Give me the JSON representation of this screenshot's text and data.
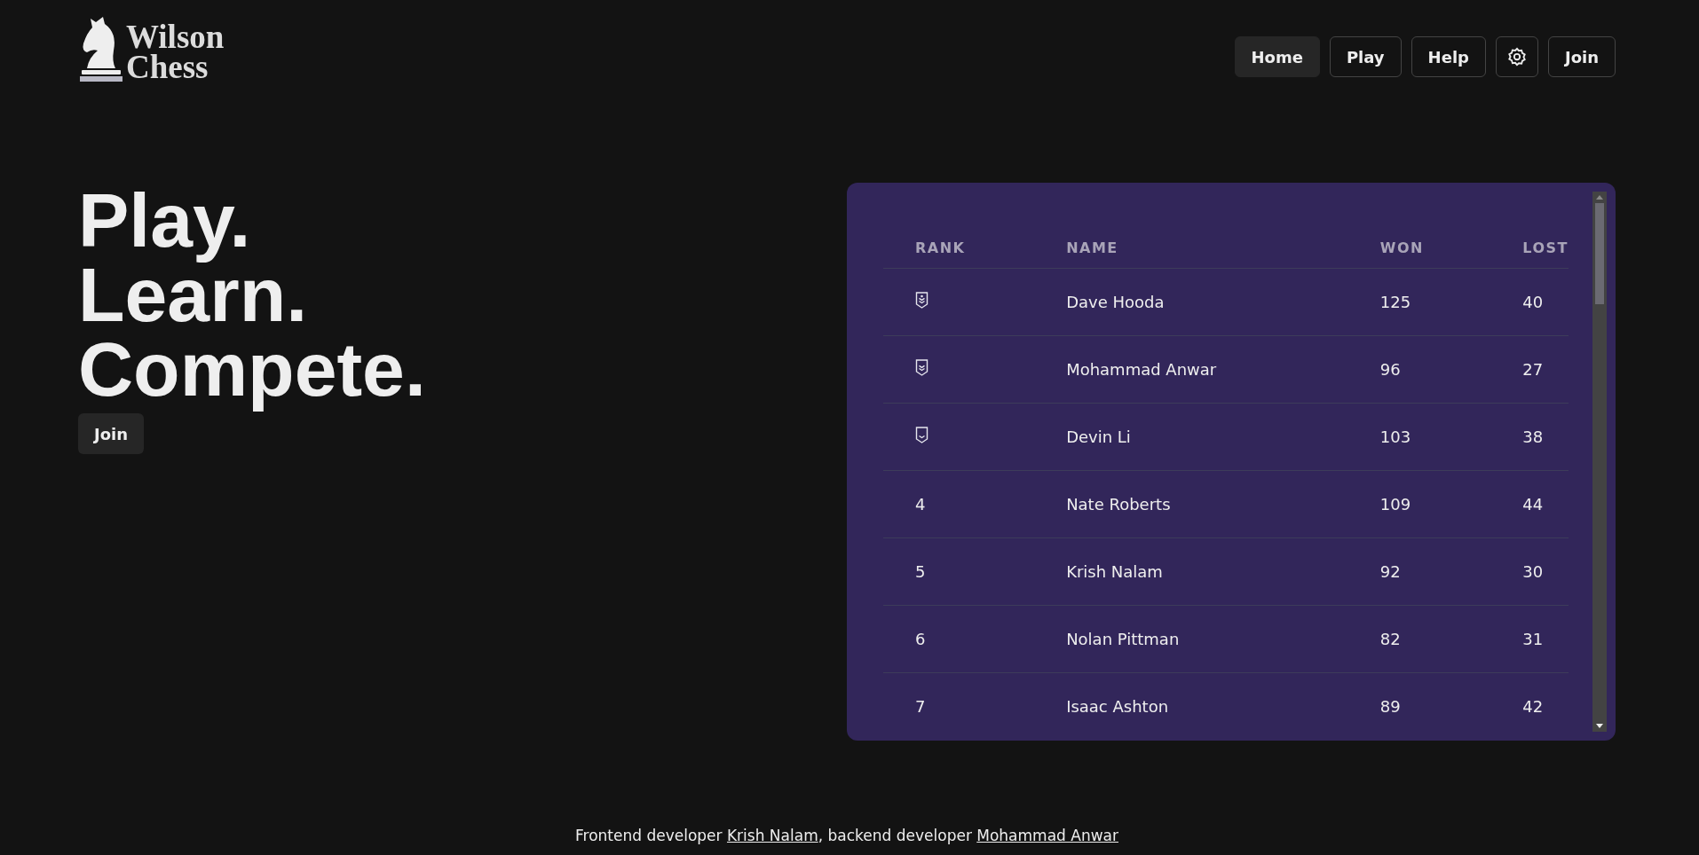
{
  "header": {
    "logo": {
      "line_1": "Wilson",
      "line_2": "Chess"
    },
    "nav": [
      {
        "kind": "link",
        "label": "Home",
        "selected": true
      },
      {
        "kind": "link",
        "label": "Play",
        "selected": false
      },
      {
        "kind": "link",
        "label": "Help",
        "selected": false
      },
      {
        "kind": "settings",
        "selected": false
      },
      {
        "kind": "link",
        "label": "Join",
        "selected": false
      }
    ]
  },
  "hero": {
    "lines": [
      "Play.",
      "Learn.",
      "Compete."
    ],
    "button": "Join"
  },
  "leaderboard": {
    "columns": [
      "RANK",
      "NAME",
      "WON",
      "LOST"
    ],
    "rows": [
      {
        "rank": {
          "kind": "gold"
        },
        "name": "Dave Hooda",
        "won": "125",
        "lost": "40"
      },
      {
        "rank": {
          "kind": "silver"
        },
        "name": "Mohammad Anwar",
        "won": "96",
        "lost": "27"
      },
      {
        "rank": {
          "kind": "bronze"
        },
        "name": "Devin Li",
        "won": "103",
        "lost": "38"
      },
      {
        "rank": {
          "kind": "number",
          "text": "4"
        },
        "name": "Nate Roberts",
        "won": "109",
        "lost": "44"
      },
      {
        "rank": {
          "kind": "number",
          "text": "5"
        },
        "name": "Krish Nalam",
        "won": "92",
        "lost": "30"
      },
      {
        "rank": {
          "kind": "number",
          "text": "6"
        },
        "name": "Nolan Pittman",
        "won": "82",
        "lost": "31"
      },
      {
        "rank": {
          "kind": "number",
          "text": "7"
        },
        "name": "Isaac Ashton",
        "won": "89",
        "lost": "42"
      }
    ]
  },
  "footer": {
    "parts": [
      {
        "kind": "text",
        "text": "Frontend developer "
      },
      {
        "kind": "link",
        "text": "Krish Nalam"
      },
      {
        "kind": "text",
        "text": ", backend developer "
      },
      {
        "kind": "link",
        "text": "Mohammad Anwar"
      }
    ]
  }
}
